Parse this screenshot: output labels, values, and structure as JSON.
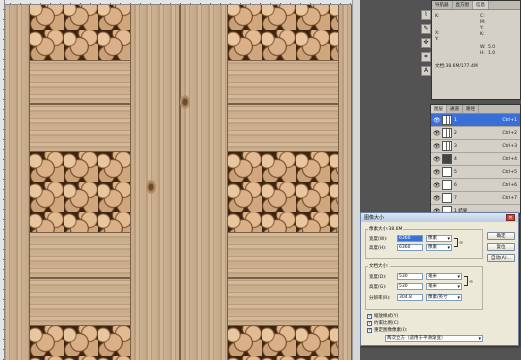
{
  "info_panel": {
    "tabs": [
      "导航器",
      "直方图",
      "信息"
    ],
    "k_label": "K:",
    "x_label": "X:",
    "y_label": "Y:",
    "c_label": "C:",
    "m_label": "M:",
    "yy_label": "Y:",
    "kk_label": "K:",
    "w_label": "W:",
    "h_label": "H:",
    "w_value": "5.0",
    "h_value": "1.0",
    "doc_label": "文档:38.6M/177.4M"
  },
  "layers_panel": {
    "tabs": [
      "图层",
      "通道",
      "路径"
    ],
    "rows": [
      {
        "name": "1",
        "shortcut": "Ctrl+1",
        "selected": true,
        "thumb": "stripes"
      },
      {
        "name": "2",
        "shortcut": "Ctrl+2",
        "selected": false,
        "thumb": "stripes"
      },
      {
        "name": "3",
        "shortcut": "Ctrl+3",
        "selected": false,
        "thumb": "stripes"
      },
      {
        "name": "4",
        "shortcut": "Ctrl+4",
        "selected": false,
        "thumb": "dark"
      },
      {
        "name": "5",
        "shortcut": "Ctrl+5",
        "selected": false,
        "thumb": "blank"
      },
      {
        "name": "6",
        "shortcut": "Ctrl+6",
        "selected": false,
        "thumb": "blank"
      },
      {
        "name": "7",
        "shortcut": "Ctrl+7",
        "selected": false,
        "thumb": "blank"
      },
      {
        "name": "1 结果",
        "shortcut": "",
        "selected": false,
        "thumb": "blank"
      }
    ]
  },
  "dialog": {
    "title": "图像大小",
    "pixel_dims": "像素大小:38.6M",
    "width_label": "宽度(W):",
    "width_value": "6360",
    "width_unit": "像素",
    "height_label": "高度(H):",
    "height_value": "6360",
    "height_unit": "像素",
    "doc_size": "文档大小:",
    "doc_width_label": "宽度(D):",
    "doc_width_value": "530",
    "doc_width_unit": "毫米",
    "doc_height_label": "高度(G):",
    "doc_height_value": "530",
    "doc_height_unit": "毫米",
    "res_label": "分辨率(R):",
    "res_value": "304.8",
    "res_unit": "像素/英寸",
    "chk_scale": "缩放样式(Y)",
    "chk_constrain": "约束比例(C)",
    "chk_resample": "重定图像像素(I):",
    "resample_method": "两次立方（适用于平滑渐变）",
    "ok_label": "确定",
    "cancel_label": "复位",
    "auto_label": "自动(A)..."
  }
}
